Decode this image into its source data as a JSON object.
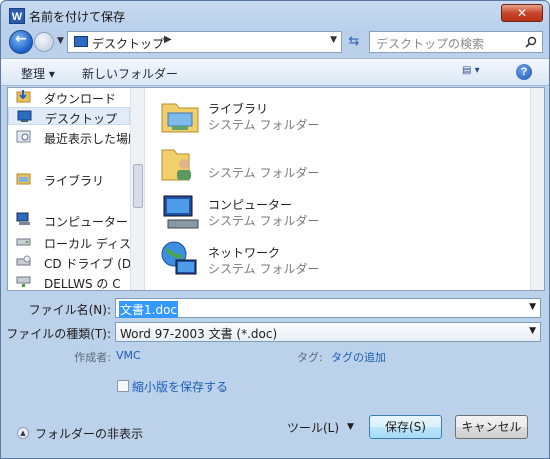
{
  "window": {
    "title": "名前を付けて保存",
    "app_icon": "W"
  },
  "address": {
    "location": "デスクトップ",
    "separator": "▶",
    "search_placeholder": "デスクトップの検索"
  },
  "toolbar": {
    "organize": "整理 ▾",
    "new_folder": "新しいフォルダー"
  },
  "nav": {
    "items": [
      {
        "label": "ダウンロード",
        "icon": "download-folder-icon"
      },
      {
        "label": "デスクトップ",
        "icon": "desktop-icon",
        "selected": true
      },
      {
        "label": "最近表示した場所",
        "icon": "recent-places-icon"
      },
      {
        "label": "ライブラリ",
        "icon": "library-icon"
      },
      {
        "label": "コンピューター",
        "icon": "computer-icon"
      },
      {
        "label": "ローカル ディスク",
        "icon": "hard-disk-icon"
      },
      {
        "label": "CD ドライブ (D",
        "icon": "cd-drive-icon"
      },
      {
        "label": "DELLWS の C",
        "icon": "network-drive-icon"
      }
    ]
  },
  "files": [
    {
      "name": "ライブラリ",
      "type": "システム フォルダー",
      "icon": "library-folder-icon"
    },
    {
      "name": "",
      "type": "システム フォルダー",
      "icon": "user-folder-icon"
    },
    {
      "name": "コンピューター",
      "type": "システム フォルダー",
      "icon": "computer-icon"
    },
    {
      "name": "ネットワーク",
      "type": "システム フォルダー",
      "icon": "network-icon"
    }
  ],
  "form": {
    "filename_label": "ファイル名(N):",
    "filename_value": "文書1.doc",
    "filetype_label": "ファイルの種類(T):",
    "filetype_value": "Word 97-2003 文書 (*.doc)",
    "author_label": "作成者:",
    "author_value": "VMC",
    "tags_label": "タグ:",
    "tags_value": "タグの追加",
    "thumbnail_label": "縮小版を保存する"
  },
  "footer": {
    "hide_folders": "フォルダーの非表示",
    "tools": "ツール(L)",
    "save": "保存(S)",
    "cancel": "キャンセル"
  },
  "colors": {
    "title_bar": "#c7daf0",
    "selection": "#3399ff",
    "link": "#1b5eb8",
    "close": "#c8462b"
  }
}
